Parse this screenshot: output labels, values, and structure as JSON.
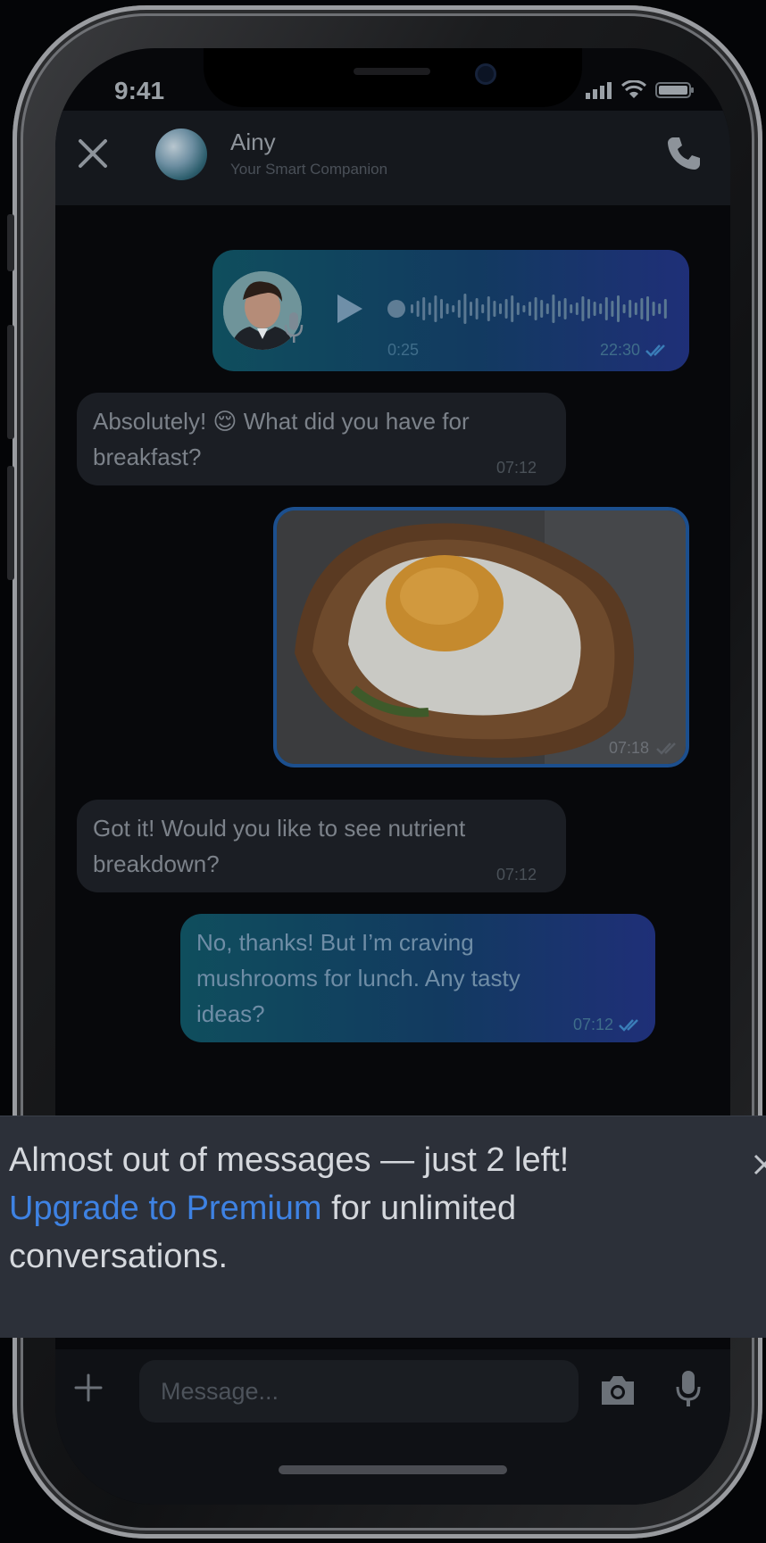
{
  "status_bar": {
    "time": "9:41"
  },
  "header": {
    "contact_name": "Ainy",
    "contact_subtitle": "Your Smart Companion"
  },
  "messages": [
    {
      "type": "voice",
      "direction": "outgoing",
      "duration": "0:25",
      "time": "22:30",
      "read": true
    },
    {
      "type": "text",
      "direction": "incoming",
      "text": "Absolutely! 😌 What did you have for breakfast?",
      "time": "07:12"
    },
    {
      "type": "image",
      "direction": "outgoing",
      "time": "07:18",
      "read": false
    },
    {
      "type": "text",
      "direction": "incoming",
      "text": "Got it! Would you like to see nutrient breakdown?",
      "time": "07:12"
    },
    {
      "type": "text",
      "direction": "outgoing",
      "text": "No, thanks! But I’m craving mushrooms for lunch. Any tasty ideas?",
      "time": "07:12",
      "read": true
    }
  ],
  "banner": {
    "line1": "Almost out of messages — just 2 left!",
    "link": "Upgrade to Premium",
    "rest": " for unlimited conversations."
  },
  "composer": {
    "placeholder": "Message..."
  },
  "colors": {
    "background": "#040507",
    "banner": "#2c3039",
    "link": "#3e82e3",
    "outgoing_bubble_start": "#0f4e5d",
    "outgoing_bubble_end": "#1f2f78",
    "incoming_bubble": "#1b1e24"
  },
  "icons": [
    "close-icon",
    "phone-icon",
    "play-icon",
    "mic-icon",
    "double-check-icon",
    "plus-icon",
    "camera-icon",
    "signal-icon",
    "wifi-icon",
    "battery-icon"
  ]
}
